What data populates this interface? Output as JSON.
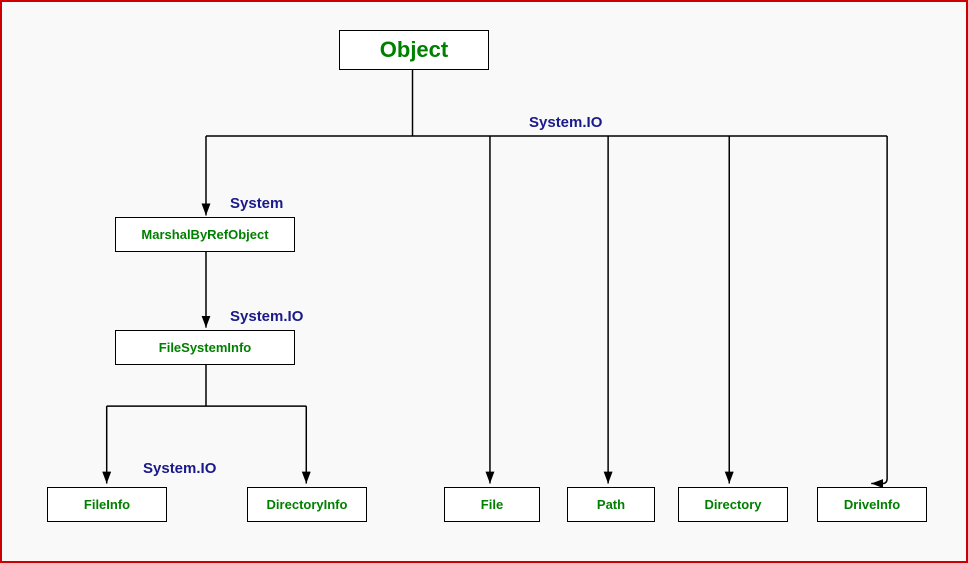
{
  "nodes": {
    "object": "Object",
    "marshal": "MarshalByRefObject",
    "fsinfo": "FileSystemInfo",
    "fileinfo": "FileInfo",
    "dirinfo": "DirectoryInfo",
    "file": "File",
    "path": "Path",
    "directory": "Directory",
    "driveinfo": "DriveInfo"
  },
  "labels": {
    "systemio_top": "System.IO",
    "system": "System",
    "systemio_mid": "System.IO",
    "systemio_low": "System.IO"
  }
}
